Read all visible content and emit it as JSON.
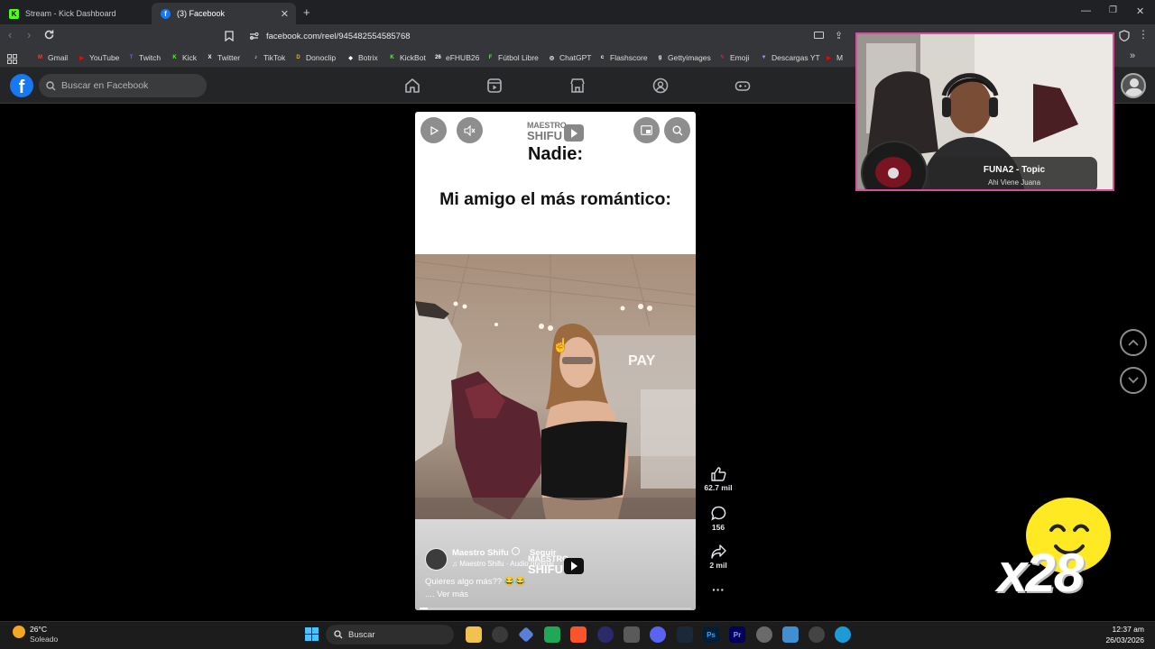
{
  "browser": {
    "tabs": [
      {
        "label": "Stream - Kick Dashboard",
        "favicon": "kick-icon",
        "color": "#53fc18"
      },
      {
        "label": "(3) Facebook",
        "favicon": "facebook-icon",
        "color": "#1877f2"
      }
    ],
    "new_tab_label": "+",
    "address": "facebook.com/reel/945482554585768",
    "bookmarks": [
      {
        "label": "Gmail",
        "color": "#ea4335",
        "glyph": "M"
      },
      {
        "label": "YouTube",
        "color": "#ff0000",
        "glyph": "▶"
      },
      {
        "label": "Twitch",
        "color": "#9146ff",
        "glyph": "T"
      },
      {
        "label": "Kick",
        "color": "#53fc18",
        "glyph": "K"
      },
      {
        "label": "Twitter",
        "color": "#ffffff",
        "glyph": "X"
      },
      {
        "label": "TikTok",
        "color": "#ffffff",
        "glyph": "♪"
      },
      {
        "label": "Donoclip",
        "color": "#f2b01e",
        "glyph": "D"
      },
      {
        "label": "Botrix",
        "color": "#ffffff",
        "glyph": "◆"
      },
      {
        "label": "KickBot",
        "color": "#53fc18",
        "glyph": "K"
      },
      {
        "label": "eFHUB26",
        "color": "#ffffff",
        "glyph": "26"
      },
      {
        "label": "Fútbol Libre",
        "color": "#7fd07a",
        "glyph": "F"
      },
      {
        "label": "ChatGPT",
        "color": "#ffffff",
        "glyph": "◎"
      },
      {
        "label": "Flashscore",
        "color": "#ffffff",
        "glyph": "c"
      },
      {
        "label": "Gettyimages",
        "color": "#ffffff",
        "glyph": "g"
      },
      {
        "label": "Emoji",
        "color": "#e2275c",
        "glyph": "ϟ"
      },
      {
        "label": "Descargas YT",
        "color": "#b58cff",
        "glyph": "▼"
      },
      {
        "label": "Mix N",
        "color": "#ff0000",
        "glyph": "▶"
      }
    ]
  },
  "facebook": {
    "logo": "f",
    "search_placeholder": "Buscar en Facebook",
    "nav_icons": [
      "home-icon",
      "video-icon",
      "marketplace-icon",
      "groups-icon",
      "gaming-icon"
    ]
  },
  "reel": {
    "top_text": "Nadie:",
    "caption_text": "Mi amigo el más romántico:",
    "watermark_line1": "MAESTRO",
    "watermark_line2": "SHIFU",
    "author": "Maestro Shifu",
    "follow": "Seguir",
    "audio": "♫ Maestro Shifu · Audio original",
    "description": "Quieres algo más?? 😂😂",
    "see_more": ".... Ver más",
    "background_sign": "PAY"
  },
  "actions": {
    "likes": "62.7 mil",
    "comments": "156",
    "shares": "2 mil",
    "more": "···"
  },
  "overlay": {
    "song_title": "FUNA2 - Topic",
    "song_subtitle": "Ahi Viene Juana",
    "multiplier": "x28"
  },
  "taskbar": {
    "temperature": "26°C",
    "weather": "Soleado",
    "search": "Buscar",
    "time": "12:37 am",
    "date": "26/03/2026"
  }
}
